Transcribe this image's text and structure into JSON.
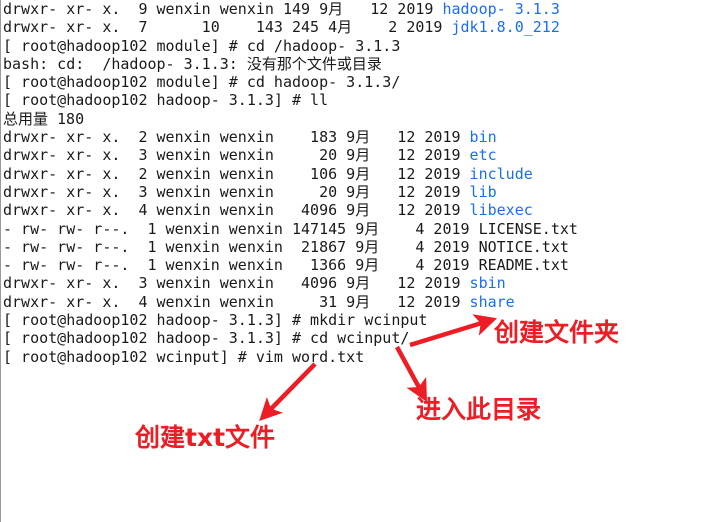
{
  "terminal": {
    "prompt_user_host": "root@hadoop102",
    "lines": [
      {
        "id": "ls-hadoop-dir",
        "pre": "drwxr- xr- x.  9 wenxin wenxin 149 9月   12 2019 ",
        "blue": "hadoop- 3.1.3",
        "post": ""
      },
      {
        "id": "ls-jdk-dir",
        "pre": "drwxr- xr- x.  7      10    143 245 4月    2 2019 ",
        "blue": "jdk1.8.0_212",
        "post": ""
      },
      {
        "id": "cmd-cd-abs",
        "pre": "[ root@hadoop102 module] # cd /hadoop- 3.1.3",
        "blue": "",
        "post": ""
      },
      {
        "id": "err-no-such-file",
        "pre": "bash: cd:  /hadoop- 3.1.3: 没有那个文件或目录",
        "blue": "",
        "post": ""
      },
      {
        "id": "cmd-cd-rel",
        "pre": "[ root@hadoop102 module] # cd hadoop- 3.1.3/",
        "blue": "",
        "post": ""
      },
      {
        "id": "cmd-ll",
        "pre": "[ root@hadoop102 hadoop- 3.1.3] # ll",
        "blue": "",
        "post": ""
      },
      {
        "id": "total-size",
        "pre": "总用量 180",
        "blue": "",
        "post": ""
      },
      {
        "id": "ls-bin",
        "pre": "drwxr- xr- x.  2 wenxin wenxin    183 9月   12 2019 ",
        "blue": "bin",
        "post": ""
      },
      {
        "id": "ls-etc",
        "pre": "drwxr- xr- x.  3 wenxin wenxin     20 9月   12 2019 ",
        "blue": "etc",
        "post": ""
      },
      {
        "id": "ls-include",
        "pre": "drwxr- xr- x.  2 wenxin wenxin    106 9月   12 2019 ",
        "blue": "include",
        "post": ""
      },
      {
        "id": "ls-lib",
        "pre": "drwxr- xr- x.  3 wenxin wenxin     20 9月   12 2019 ",
        "blue": "lib",
        "post": ""
      },
      {
        "id": "ls-libexec",
        "pre": "drwxr- xr- x.  4 wenxin wenxin   4096 9月   12 2019 ",
        "blue": "libexec",
        "post": ""
      },
      {
        "id": "ls-license",
        "pre": "- rw- rw- r--.  1 wenxin wenxin 147145 9月    4 2019 LICENSE.txt",
        "blue": "",
        "post": ""
      },
      {
        "id": "ls-notice",
        "pre": "- rw- rw- r--.  1 wenxin wenxin  21867 9月    4 2019 NOTICE.txt",
        "blue": "",
        "post": ""
      },
      {
        "id": "ls-readme",
        "pre": "- rw- rw- r--.  1 wenxin wenxin   1366 9月    4 2019 README.txt",
        "blue": "",
        "post": ""
      },
      {
        "id": "ls-sbin",
        "pre": "drwxr- xr- x.  3 wenxin wenxin   4096 9月   12 2019 ",
        "blue": "sbin",
        "post": ""
      },
      {
        "id": "ls-share",
        "pre": "drwxr- xr- x.  4 wenxin wenxin     31 9月   12 2019 ",
        "blue": "share",
        "post": ""
      },
      {
        "id": "cmd-mkdir",
        "pre": "[ root@hadoop102 hadoop- 3.1.3] # mkdir wcinput",
        "blue": "",
        "post": ""
      },
      {
        "id": "cmd-cd-wcinput",
        "pre": "[ root@hadoop102 hadoop- 3.1.3] # cd wcinput/",
        "blue": "",
        "post": ""
      },
      {
        "id": "cmd-vim-word",
        "pre": "[ root@hadoop102 wcinput] # vim word.txt",
        "blue": "",
        "post": ""
      }
    ]
  },
  "annotations": {
    "color": "#ee1c25",
    "create_folder": "创建文件夹",
    "enter_directory": "进入此目录",
    "create_txt_file": "创建txt文件"
  },
  "colors": {
    "background": "#ffffff",
    "text": "#1a1a1a",
    "directory_blue": "#1a6ef5",
    "annotation_red": "#ee1c25",
    "left_rule": "#9a9a9a"
  }
}
